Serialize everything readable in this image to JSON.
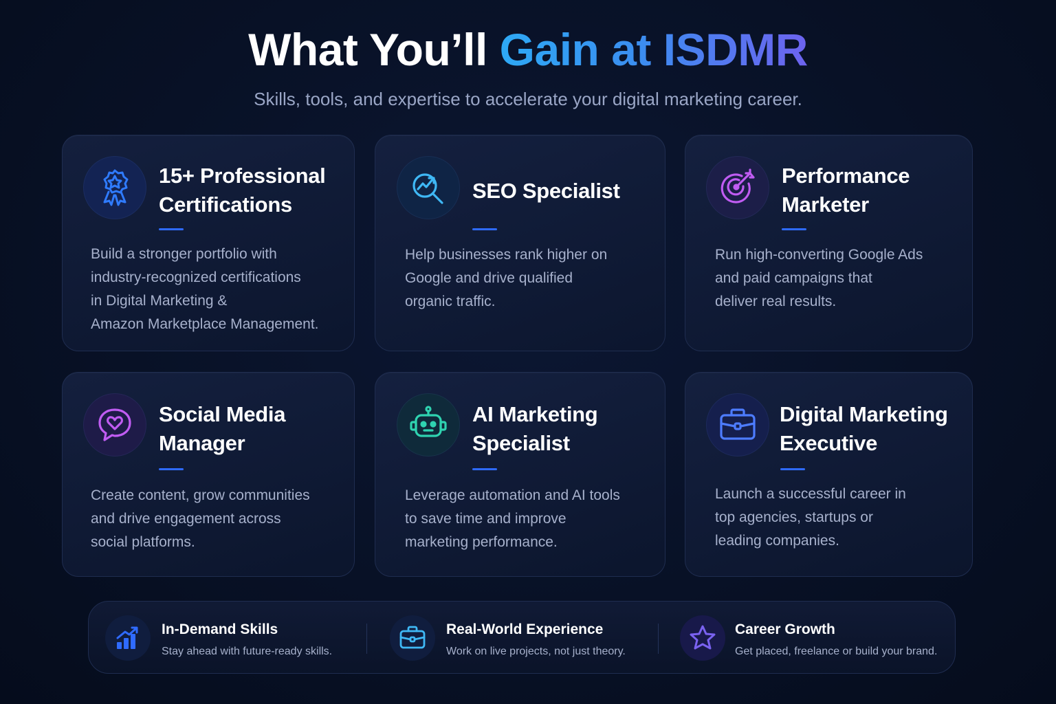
{
  "header": {
    "title_main": "What You’ll ",
    "title_accent": "Gain at ISDMR",
    "subtitle": "Skills, tools, and expertise to accelerate your digital marketing career."
  },
  "cards": [
    {
      "icon": "award-ribbon-icon",
      "title": "15+ Professional\nCertifications",
      "description": "Build a stronger portfolio with\nindustry-recognized certifications\nin Digital Marketing &\nAmazon Marketplace Management."
    },
    {
      "icon": "search-growth-icon",
      "title": "SEO Specialist",
      "description": "Help businesses rank higher on\nGoogle and drive qualified\norganic traffic."
    },
    {
      "icon": "target-arrow-icon",
      "title": "Performance\nMarketer",
      "description": "Run high-converting Google Ads\nand paid campaigns that\ndeliver real results."
    },
    {
      "icon": "chat-heart-icon",
      "title": "Social Media\nManager",
      "description": "Create content, grow communities\nand drive engagement across\nsocial platforms."
    },
    {
      "icon": "robot-icon",
      "title": "AI Marketing\nSpecialist",
      "description": "Leverage automation and AI tools\nto save time and improve\nmarketing performance."
    },
    {
      "icon": "briefcase-icon",
      "title": "Digital Marketing\nExecutive",
      "description": "Launch a successful career in\ntop agencies, startups or\nleading companies."
    }
  ],
  "features": [
    {
      "icon": "bar-chart-growth-icon",
      "title": "In-Demand Skills",
      "description": "Stay ahead with future-ready skills."
    },
    {
      "icon": "briefcase-icon",
      "title": "Real-World Experience",
      "description": "Work on live projects, not just theory."
    },
    {
      "icon": "star-icon",
      "title": "Career Growth",
      "description": "Get placed, freelance or build your brand."
    }
  ],
  "colors": {
    "background": "#081126",
    "accent_blue": "#2f6bff",
    "accent_cyan": "#2ea9f5",
    "accent_purple": "#b65cf0",
    "accent_teal": "#2fd3b0",
    "accent_indigo": "#6d63ef"
  }
}
